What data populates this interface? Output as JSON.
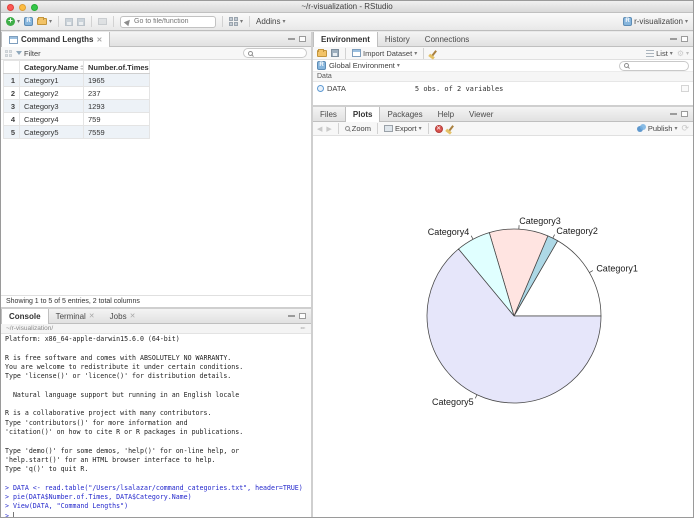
{
  "window": {
    "title": "~/r-visualization - RStudio"
  },
  "toolbar": {
    "goto_placeholder": "Go to file/function",
    "addins_label": "Addins",
    "project_label": "r-visualization"
  },
  "viewer_pane": {
    "tab_title": "Command Lengths",
    "filter_label": "Filter",
    "status": "Showing 1 to 5 of 5 entries, 2 total columns",
    "table": {
      "columns": [
        "Category.Name",
        "Number.of.Times"
      ],
      "rows": [
        {
          "n": "1",
          "name": "Category1",
          "times": "1965"
        },
        {
          "n": "2",
          "name": "Category2",
          "times": "237"
        },
        {
          "n": "3",
          "name": "Category3",
          "times": "1293"
        },
        {
          "n": "4",
          "name": "Category4",
          "times": "759"
        },
        {
          "n": "5",
          "name": "Category5",
          "times": "7559"
        }
      ]
    }
  },
  "console_pane": {
    "tabs": [
      "Console",
      "Terminal",
      "Jobs"
    ],
    "path": "~/r-visualization/",
    "output_lines": [
      "Platform: x86_64-apple-darwin15.6.0 (64-bit)",
      "",
      "R is free software and comes with ABSOLUTELY NO WARRANTY.",
      "You are welcome to redistribute it under certain conditions.",
      "Type 'license()' or 'licence()' for distribution details.",
      "",
      "  Natural language support but running in an English locale",
      "",
      "R is a collaborative project with many contributors.",
      "Type 'contributors()' for more information and",
      "'citation()' on how to cite R or R packages in publications.",
      "",
      "Type 'demo()' for some demos, 'help()' for on-line help, or",
      "'help.start()' for an HTML browser interface to help.",
      "Type 'q()' to quit R.",
      ""
    ],
    "commands": [
      "DATA <- read.table(\"/Users/lsalazar/command_categories.txt\", header=TRUE)",
      "pie(DATA$Number.of.Times, DATA$Category.Name)",
      "View(DATA, \"Command Lengths\")"
    ],
    "prompt": ">"
  },
  "environment_pane": {
    "tabs": [
      "Environment",
      "History",
      "Connections"
    ],
    "import_label": "Import Dataset",
    "list_label": "List",
    "scope_label": "Global Environment",
    "section_label": "Data",
    "objects": [
      {
        "name": "DATA",
        "summary": "5 obs. of 2 variables"
      }
    ]
  },
  "plots_pane": {
    "tabs": [
      "Files",
      "Plots",
      "Packages",
      "Help",
      "Viewer"
    ],
    "zoom_label": "Zoom",
    "export_label": "Export",
    "publish_label": "Publish"
  },
  "chart_data": {
    "type": "pie",
    "title": "",
    "categories": [
      "Category1",
      "Category2",
      "Category3",
      "Category4",
      "Category5"
    ],
    "values": [
      1965,
      237,
      1293,
      759,
      7559
    ],
    "colors": [
      "#FFFFFF",
      "#ADD8E6",
      "#FFE4E1",
      "#E0FFFF",
      "#E6E6FA"
    ],
    "start_angle_deg": 0,
    "direction": "counterclockwise",
    "stroke_color": "#454545"
  }
}
